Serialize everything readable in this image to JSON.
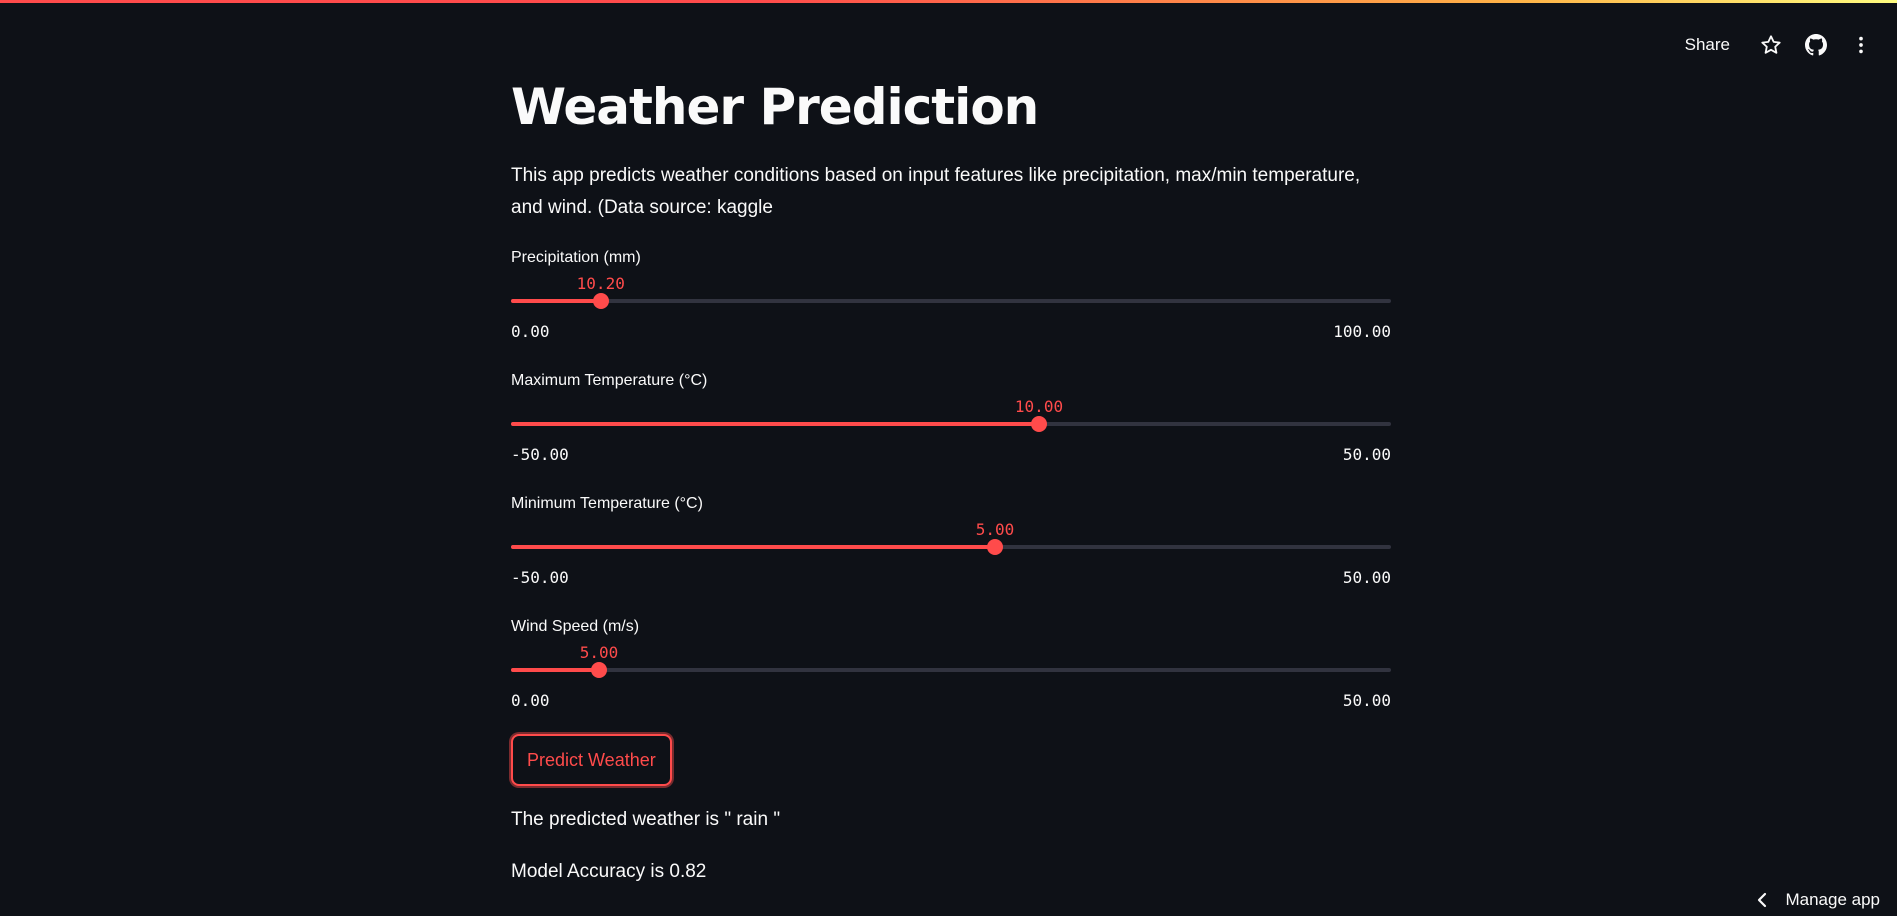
{
  "header": {
    "share_label": "Share",
    "icons": [
      "star-icon",
      "github-icon",
      "more-vertical-icon"
    ]
  },
  "main": {
    "title": "Weather Prediction",
    "description": "This app predicts weather conditions based on input features like precipitation, max/min temperature, and wind. (Data source: kaggle"
  },
  "sliders": [
    {
      "label": "Precipitation (mm)",
      "value": "10.20",
      "min": "0.00",
      "max": "100.00",
      "fraction": 0.102
    },
    {
      "label": "Maximum Temperature (°C)",
      "value": "10.00",
      "min": "-50.00",
      "max": "50.00",
      "fraction": 0.6
    },
    {
      "label": "Minimum Temperature (°C)",
      "value": "5.00",
      "min": "-50.00",
      "max": "50.00",
      "fraction": 0.55
    },
    {
      "label": "Wind Speed (m/s)",
      "value": "5.00",
      "min": "0.00",
      "max": "50.00",
      "fraction": 0.1
    }
  ],
  "actions": {
    "predict_label": "Predict Weather"
  },
  "results": {
    "prediction": "The predicted weather is \" rain \"",
    "accuracy": "Model Accuracy is 0.82"
  },
  "footer": {
    "manage_label": "Manage app"
  },
  "colors": {
    "background": "#0e1117",
    "accent": "#ff4b4b",
    "track": "#31333f",
    "text": "#fafafa"
  }
}
